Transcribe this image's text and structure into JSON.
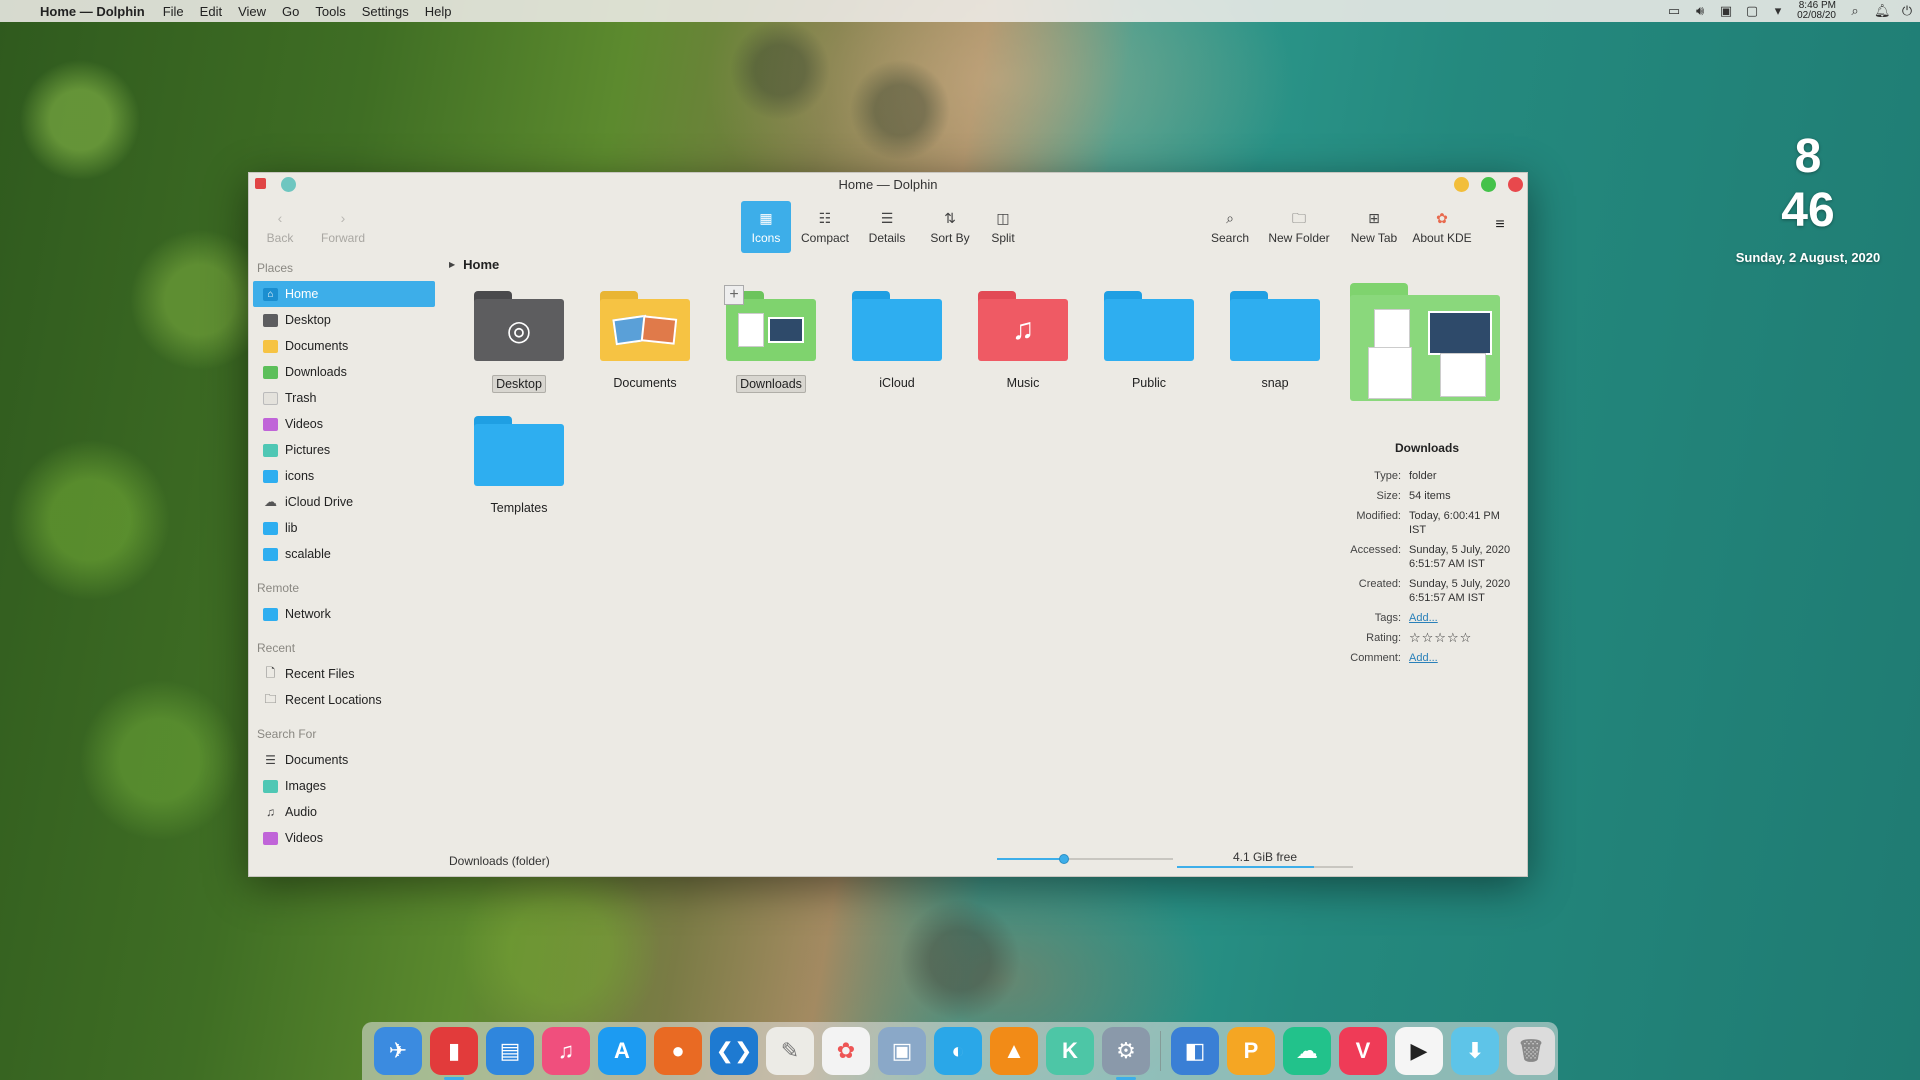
{
  "menubar": {
    "apple_symbol": "",
    "app_title": "Home — Dolphin",
    "menus": [
      "File",
      "Edit",
      "View",
      "Go",
      "Tools",
      "Settings",
      "Help"
    ],
    "time": "8:46 PM",
    "date": "02/08/20",
    "tray_icons": [
      "clipboard-icon",
      "volume-icon",
      "input-method-icon",
      "display-icon",
      "chevron-down-icon",
      "search-icon",
      "notifications-icon",
      "power-icon"
    ]
  },
  "desktop_clock": {
    "hour": "8",
    "minute": "46",
    "date": "Sunday, 2 August, 2020"
  },
  "window": {
    "title": "Home — Dolphin",
    "toolbar": {
      "back": "Back",
      "forward": "Forward",
      "icons": "Icons",
      "compact": "Compact",
      "details": "Details",
      "sort_by": "Sort By",
      "split": "Split",
      "search": "Search",
      "new_folder": "New Folder",
      "new_tab": "New Tab",
      "about_kde": "About KDE"
    },
    "sidebar": {
      "places_header": "Places",
      "places": [
        "Home",
        "Desktop",
        "Documents",
        "Downloads",
        "Trash",
        "Videos",
        "Pictures",
        "icons",
        "iCloud Drive",
        "lib",
        "scalable"
      ],
      "remote_header": "Remote",
      "remote": [
        "Network"
      ],
      "recent_header": "Recent",
      "recent": [
        "Recent Files",
        "Recent Locations"
      ],
      "search_header": "Search For",
      "search": [
        "Documents",
        "Images",
        "Audio",
        "Videos"
      ]
    },
    "breadcrumb": "Home",
    "items": [
      "Desktop",
      "Documents",
      "Downloads",
      "iCloud",
      "Music",
      "Public",
      "snap",
      "Templates"
    ],
    "info_panel": {
      "name": "Downloads",
      "type_label": "Type:",
      "type": "folder",
      "size_label": "Size:",
      "size": "54 items",
      "modified_label": "Modified:",
      "modified": "Today, 6:00:41 PM IST",
      "accessed_label": "Accessed:",
      "accessed": "Sunday, 5 July, 2020 6:51:57 AM IST",
      "created_label": "Created:",
      "created": "Sunday, 5 July, 2020 6:51:57 AM IST",
      "tags_label": "Tags:",
      "tags": "Add...",
      "rating_label": "Rating:",
      "rating_stars": "☆☆☆☆☆",
      "comment_label": "Comment:",
      "comment": "Add..."
    },
    "statusbar": {
      "status_text": "Downloads (folder)",
      "zoom_level": 0.38,
      "free_space": "4.1 GiB free",
      "used_fraction": 0.78
    }
  },
  "colors": {
    "accent": "#3daee9",
    "folder_blue": "#2eaef0",
    "folder_green": "#7fd36e",
    "folder_red": "#ef5a64",
    "folder_gray": "#5d5d5f",
    "folder_yellow": "#f6c343"
  },
  "dock": {
    "apps": [
      "launcher",
      "finder",
      "files",
      "music",
      "app-store",
      "firefox",
      "vscode",
      "text-editor",
      "photos",
      "image-viewer",
      "vpn",
      "vlc",
      "kvantum",
      "system-settings",
      "window-manager",
      "pdf",
      "cloud",
      "vivaldi",
      "screen-recorder",
      "downloader",
      "trash"
    ]
  }
}
